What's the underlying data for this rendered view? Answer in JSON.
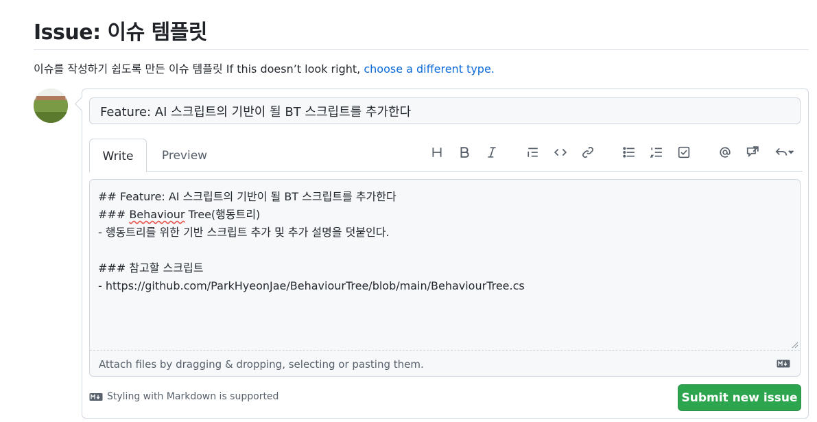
{
  "header": {
    "title": "Issue: 이슈 템플릿",
    "description": "이슈를 작성하기 쉽도록 만든 이슈 템플릿 If this doesn’t look right,",
    "change_type_link": "choose a different type."
  },
  "form": {
    "title_value": "Feature: AI 스크립트의 기반이 될 BT 스크립트를 추가한다",
    "tabs": {
      "write": "Write",
      "preview": "Preview"
    },
    "toolbar_icons": [
      "heading-icon",
      "bold-icon",
      "italic-icon",
      "quote-icon",
      "code-icon",
      "link-icon",
      "bulleted-list-icon",
      "numbered-list-icon",
      "task-list-icon",
      "mention-icon",
      "reference-icon",
      "reply-icon"
    ],
    "body": {
      "line1": "## Feature: AI 스크립트의 기반이 될 BT 스크립트를 추가한다",
      "line2_prefix": "### ",
      "line2_word": "Behaviour",
      "line2_suffix": " Tree(행동트리)",
      "line3": "- 행동트리를 위한 기반 스크립트 추가 및 추가 설명을 덧붙인다.",
      "line4": "",
      "line5": "### 참고할 스크립트",
      "line6": "- https://github.com/ParkHyeonJae/BehaviourTree/blob/main/BehaviourTree.cs"
    },
    "attach_hint": "Attach files by dragging & dropping, selecting or pasting them.",
    "markdown_note": "Styling with Markdown is supported",
    "submit_label": "Submit new issue"
  },
  "colors": {
    "accent_link": "#0969da",
    "submit_green": "#2da44e",
    "border": "#d0d7de",
    "muted_text": "#57606a"
  }
}
